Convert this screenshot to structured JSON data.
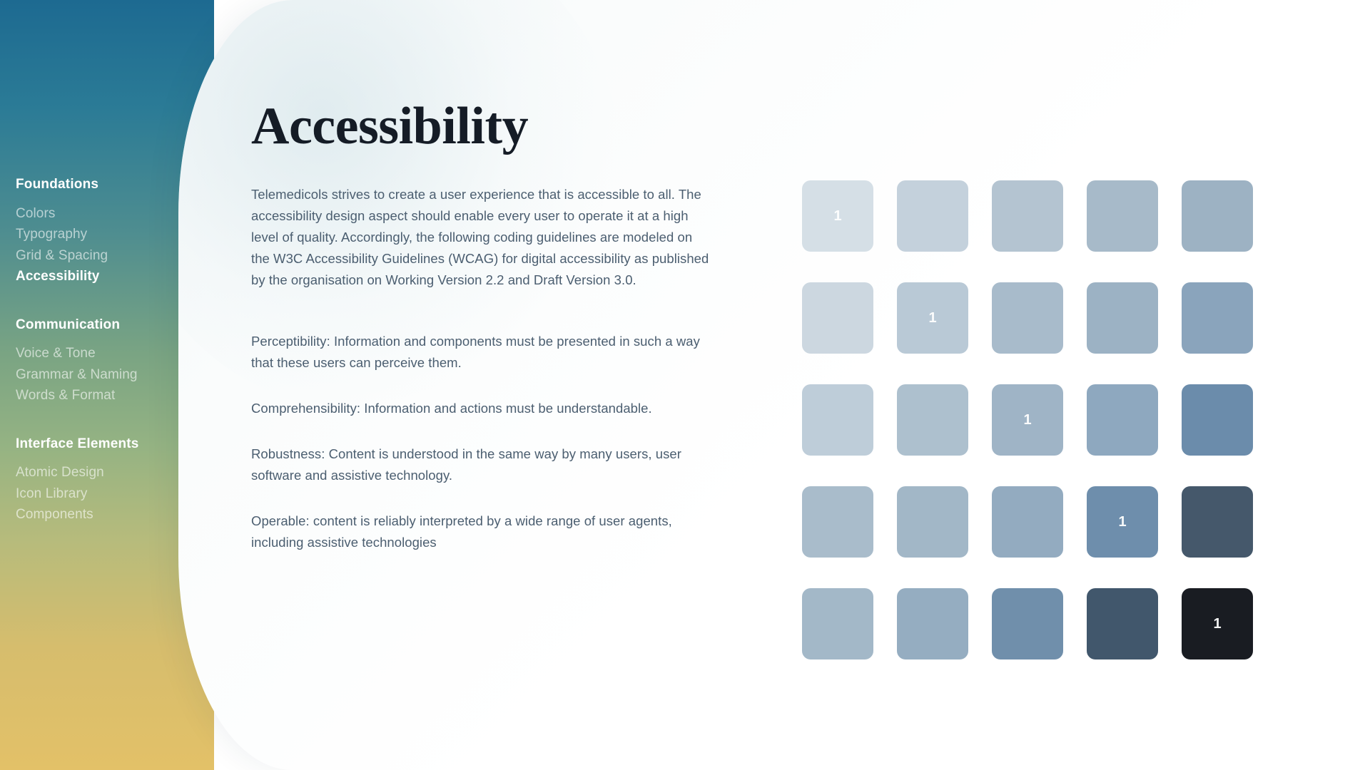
{
  "sidebar": {
    "groups": [
      {
        "title": "Foundations",
        "items": [
          {
            "label": "Colors",
            "active": false
          },
          {
            "label": "Typography",
            "active": false
          },
          {
            "label": "Grid & Spacing",
            "active": false
          },
          {
            "label": "Accessibility",
            "active": true
          }
        ]
      },
      {
        "title": "Communication",
        "items": [
          {
            "label": "Voice & Tone",
            "active": false
          },
          {
            "label": "Grammar & Naming",
            "active": false
          },
          {
            "label": "Words & Format",
            "active": false
          }
        ]
      },
      {
        "title": "Interface Elements",
        "items": [
          {
            "label": "Atomic Design",
            "active": false
          },
          {
            "label": "Icon Library",
            "active": false
          },
          {
            "label": "Components",
            "active": false
          }
        ]
      }
    ],
    "gradient_colors": [
      "#1d6a91",
      "#7aa483",
      "#e3c168"
    ]
  },
  "article": {
    "title": "Accessibility",
    "intro": "Telemedicols strives to create a user experience that is accessible to all. The accessibility design aspect should enable every user to operate it at a high level of quality. Accordingly, the following coding guidelines are modeled on the W3C Accessibility Guidelines (WCAG) for digital accessibility as published by the organisation on Working Version 2.2 and Draft Version 3.0.",
    "principles": [
      "Perceptibility: Information and components must be presented in such a way that these users can perceive them.",
      "Comprehensibility: Information and actions must be understandable.",
      "Robustness: Content is understood in the same way by many users, user software and assistive technology.",
      "Operable: content is reliably interpreted by a wide range of user agents, including assistive technologies"
    ]
  },
  "swatch_grid": {
    "columns": 5,
    "rows": 5,
    "cells": [
      {
        "color": "#d5dfe6",
        "label": "1"
      },
      {
        "color": "#c4d1dc",
        "label": ""
      },
      {
        "color": "#b4c4d1",
        "label": ""
      },
      {
        "color": "#a7bac9",
        "label": ""
      },
      {
        "color": "#9db2c3",
        "label": ""
      },
      {
        "color": "#ccd7e0",
        "label": ""
      },
      {
        "color": "#b9c9d6",
        "label": "1"
      },
      {
        "color": "#a8bbcb",
        "label": ""
      },
      {
        "color": "#9cb2c4",
        "label": ""
      },
      {
        "color": "#8aa4bc",
        "label": ""
      },
      {
        "color": "#becdd9",
        "label": ""
      },
      {
        "color": "#adc0ce",
        "label": ""
      },
      {
        "color": "#9fb4c6",
        "label": "1"
      },
      {
        "color": "#8ea8bf",
        "label": ""
      },
      {
        "color": "#6b8cab",
        "label": ""
      },
      {
        "color": "#a9bccb",
        "label": ""
      },
      {
        "color": "#a2b7c7",
        "label": ""
      },
      {
        "color": "#93abc0",
        "label": ""
      },
      {
        "color": "#6e8eac",
        "label": "1"
      },
      {
        "color": "#45586b",
        "label": ""
      },
      {
        "color": "#a3b8c8",
        "label": ""
      },
      {
        "color": "#95adc1",
        "label": ""
      },
      {
        "color": "#708fab",
        "label": ""
      },
      {
        "color": "#41576c",
        "label": ""
      },
      {
        "color": "#191c22",
        "label": "1"
      }
    ]
  }
}
